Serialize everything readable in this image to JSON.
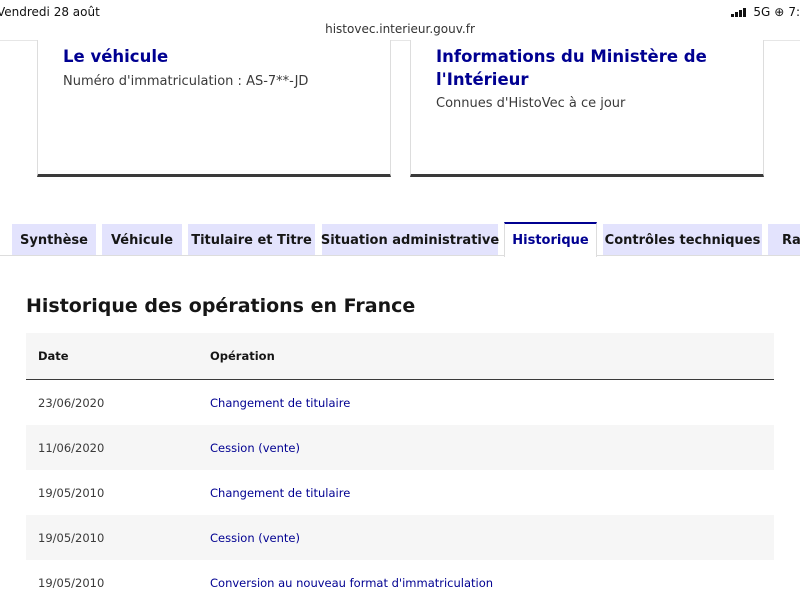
{
  "status_bar": {
    "date": "Vendredi 28 août",
    "network": "5G",
    "clock": "7:"
  },
  "browser": {
    "url": "histovec.interieur.gouv.fr"
  },
  "cards": [
    {
      "title": "Le véhicule",
      "description": "Numéro d'immatriculation : AS-7**-JD"
    },
    {
      "title": "Informations du Ministère de l'Intérieur",
      "description": "Connues d'HistoVec à ce jour"
    }
  ],
  "tabs": [
    {
      "label": "Synthèse",
      "active": false
    },
    {
      "label": "Véhicule",
      "active": false
    },
    {
      "label": "Titulaire et Titre",
      "active": false
    },
    {
      "label": "Situation administrative",
      "active": false
    },
    {
      "label": "Historique",
      "active": true
    },
    {
      "label": "Contrôles techniques",
      "active": false
    },
    {
      "label": "Rap",
      "active": false
    }
  ],
  "section": {
    "title": "Historique des opérations en France"
  },
  "table": {
    "headers": {
      "date": "Date",
      "operation": "Opération"
    },
    "rows": [
      {
        "date": "23/06/2020",
        "operation": "Changement de titulaire"
      },
      {
        "date": "11/06/2020",
        "operation": "Cession (vente)"
      },
      {
        "date": "19/05/2010",
        "operation": "Changement de titulaire"
      },
      {
        "date": "19/05/2010",
        "operation": "Cession (vente)"
      },
      {
        "date": "19/05/2010",
        "operation": "Conversion au nouveau format d'immatriculation"
      }
    ]
  },
  "colors": {
    "accent": "#000091",
    "tab_bg": "#e3e3fd",
    "row_alt": "#f6f6f6"
  }
}
